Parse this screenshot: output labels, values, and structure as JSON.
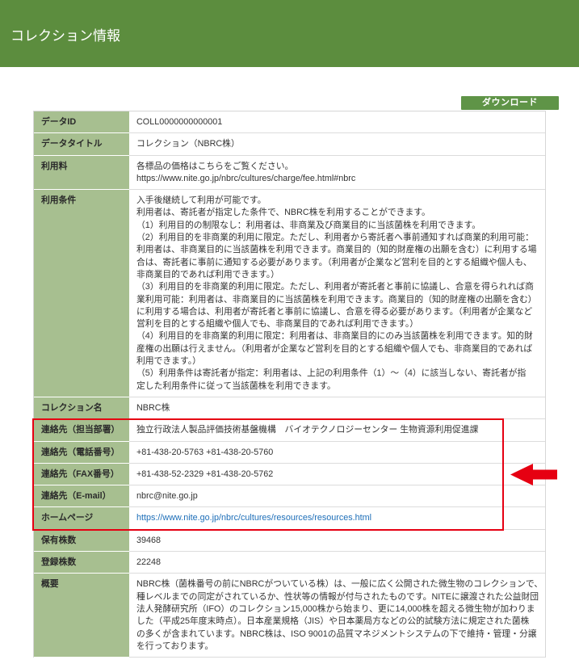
{
  "header": {
    "title": "コレクション情報"
  },
  "download": {
    "label": "ダウンロード"
  },
  "colors": {
    "header_bg": "#5c8d3e",
    "label_bg": "#a7bf90",
    "button_bg": "#5f9447",
    "link": "#1d6eb8",
    "highlight": "#e60012"
  },
  "annotations": {
    "arrow_icon": "left-arrow-icon"
  },
  "details": {
    "rows": [
      {
        "label": "データID",
        "lines": [
          "COLL0000000000001"
        ]
      },
      {
        "label": "データタイトル",
        "lines": [
          "コレクション（NBRC株）"
        ]
      },
      {
        "label": "利用料",
        "lines": [
          "各標品の価格はこちらをご覧ください。",
          "https://www.nite.go.jp/nbrc/cultures/charge/fee.html#nbrc"
        ]
      },
      {
        "label": "利用条件",
        "lines": [
          "入手後継続して利用が可能です。",
          "利用者は、寄託者が指定した条件で、NBRC株を利用することができます。",
          "（1）利用目的の制限なし：利用者は、非商業及び商業目的に当該菌株を利用できます。",
          "（2）利用目的を非商業的利用に限定。ただし、利用者から寄託者へ事前通知すれば商業的利用可能：",
          "利用者は、非商業目的に当該菌株を利用できます。商業目的（知的財産権の出願を含む）に利用する場",
          "合は、寄託者に事前に通知する必要があります。（利用者が企業など営利を目的とする組織や個人も、",
          "非商業目的であれば利用できます。）",
          "（3）利用目的を非商業的利用に限定。ただし、利用者が寄託者と事前に協議し、合意を得られれば商",
          "業利用可能：利用者は、非商業目的に当該菌株を利用できます。商業目的（知的財産権の出願を含む）",
          "に利用する場合は、利用者が寄託者と事前に協議し、合意を得る必要があります。（利用者が企業など",
          "営利を目的とする組織や個人でも、非商業目的であれば利用できます。）",
          "（4）利用目的を非商業的利用に限定：利用者は、非商業目的にのみ当該菌株を利用できます。知的財",
          "産権の出願は行えません。（利用者が企業など営利を目的とする組織や個人でも、非商業目的であれば",
          "利用できます。）",
          "（5）利用条件は寄託者が指定：利用者は、上記の利用条件（1）～（4）に該当しない、寄託者が指",
          "定した利用条件に従って当該菌株を利用できます。"
        ]
      },
      {
        "label": "コレクション名",
        "lines": [
          "NBRC株"
        ]
      },
      {
        "label": "連絡先（担当部署）",
        "lines": [
          "独立行政法人製品評価技術基盤機構　バイオテクノロジーセンター 生物資源利用促進課"
        ]
      },
      {
        "label": "連絡先（電話番号）",
        "lines": [
          "+81-438-20-5763 +81-438-20-5760"
        ]
      },
      {
        "label": "連絡先（FAX番号）",
        "lines": [
          "+81-438-52-2329 +81-438-20-5762"
        ]
      },
      {
        "label": "連絡先（E-mail）",
        "lines": [
          "nbrc@nite.go.jp"
        ]
      },
      {
        "label": "ホームページ",
        "lines": [
          "https://www.nite.go.jp/nbrc/cultures/resources/resources.html"
        ],
        "link": true
      },
      {
        "label": "保有株数",
        "lines": [
          "39468"
        ]
      },
      {
        "label": "登録株数",
        "lines": [
          "22248"
        ]
      },
      {
        "label": "概要",
        "lines": [
          "NBRC株（菌株番号の前にNBRCがついている株）は、一般に広く公開された微生物のコレクションで、",
          "種レベルまでの同定がされているか、性状等の情報が付与されたものです。NITEに譲渡された公益財団",
          "法人発酵研究所（IFO）のコレクション15,000株から始まり、更に14,000株を超える微生物が加わりま",
          "した（平成25年度末時点）。日本産業規格（JIS）や日本薬局方などの公的試験方法に規定された菌株",
          "の多くが含まれています。NBRC株は、ISO 9001の品質マネジメントシステムの下で維持・管理・分譲",
          "を行っております。"
        ]
      }
    ]
  }
}
